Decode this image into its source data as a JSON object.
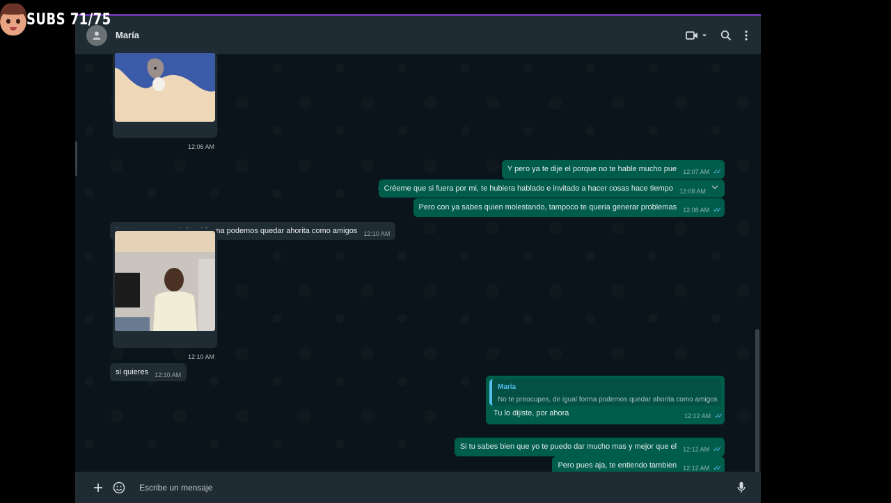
{
  "overlay": {
    "subs_label": "SUBS 71/75"
  },
  "header": {
    "contact_name": "María",
    "icons": [
      "person-icon",
      "video-call-icon",
      "chevron-down-icon",
      "search-icon",
      "menu-icon"
    ]
  },
  "messages": {
    "img1_time": "12:06 AM",
    "m1": {
      "text": "Y pero ya te dije el porque no te hable mucho pue",
      "time": "12:07 AM"
    },
    "m2": {
      "text": "Créeme que si fuera por mi, te hubiera hablado e invitado a hacer cosas hace tiempo",
      "time": "12:08 AM"
    },
    "m3": {
      "text": "Pero con ya sabes quien molestando, tampoco te queria generar problemas",
      "time": "12:08 AM"
    },
    "m4": {
      "text": "No te preocupes, de igual forma podemos quedar ahorita como amigos",
      "time": "12:10 AM"
    },
    "img2_time": "12:10 AM",
    "m5": {
      "text": "si quieres",
      "time": "12:10 AM"
    },
    "m6": {
      "quote_name": "María",
      "quote_text": "No te preocupes, de igual forma podemos quedar ahorita como amigos",
      "text": "Tu lo dijiste, por ahora",
      "time": "12:12 AM"
    },
    "m7": {
      "text": "Si tu sabes bien que yo te puedo dar mucho mas y mejor que el",
      "time": "12:12 AM"
    },
    "m8": {
      "text": "Pero pues aja, te entiendo tambien",
      "time": "12:12 AM"
    }
  },
  "composer": {
    "placeholder": "Escribe un mensaje",
    "icons": [
      "plus-icon",
      "sticker-icon",
      "microphone-icon"
    ]
  },
  "colors": {
    "incoming": "#202c33",
    "outgoing": "#005c4b",
    "read_ticks": "#53bdeb",
    "background": "#0b141a"
  }
}
